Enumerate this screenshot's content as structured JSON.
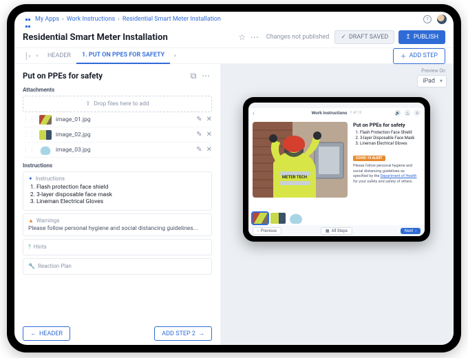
{
  "breadcrumbs": {
    "a": "My Apps",
    "b": "Work Instructions",
    "c": "Residential Smart Meter Installation"
  },
  "title": "Residential Smart Meter Installation",
  "statusbar": {
    "changes": "Changes not published",
    "draft": "DRAFT SAVED",
    "publish": "PUBLISH"
  },
  "tabs": {
    "header": "HEADER",
    "step1": "1. PUT ON PPES FOR SAFETY",
    "addstep": "ADD STEP"
  },
  "step": {
    "title": "Put on PPEs for safety",
    "attachments_label": "Attachments",
    "dropzone": "Drop files here to add",
    "files": [
      {
        "name": "image_01.jpg"
      },
      {
        "name": "image_02.jpg"
      },
      {
        "name": "image_03.jpg"
      }
    ],
    "instructions_label": "Instructions",
    "instructions_card_hdr": "Instructions",
    "instructions": [
      "Flash protection face shield",
      "3-layer disposable face mask",
      "Lineman Electrical Gloves"
    ],
    "warnings_hdr": "Warnings",
    "warnings_text": "Please follow personal hygiene and social distancing guidelines...",
    "hints_hdr": "Hints",
    "reaction_hdr": "Reaction Plan",
    "back_btn": "HEADER",
    "next_btn": "ADD STEP 2"
  },
  "preview": {
    "label": "Preview On",
    "device": "iPad",
    "runtime": {
      "app_title": "Work Instructions",
      "progress": "1 of 12",
      "step_title": "Put on PPEs for safety",
      "items": [
        "Flash Protection Face Shield",
        "3-layer Disposable Face Mask",
        "Lineman Electrical Gloves"
      ],
      "badge": "COVID-19 ALERT",
      "para_a": "Please follow personal hygiene and social distancing guidelines as specified by the ",
      "para_link": "Department of Health",
      "para_b": " for your safety and safety of others.",
      "prev": "Previous",
      "allsteps": "All Steps",
      "next": "Next",
      "vest_text": "METER TECH"
    }
  }
}
